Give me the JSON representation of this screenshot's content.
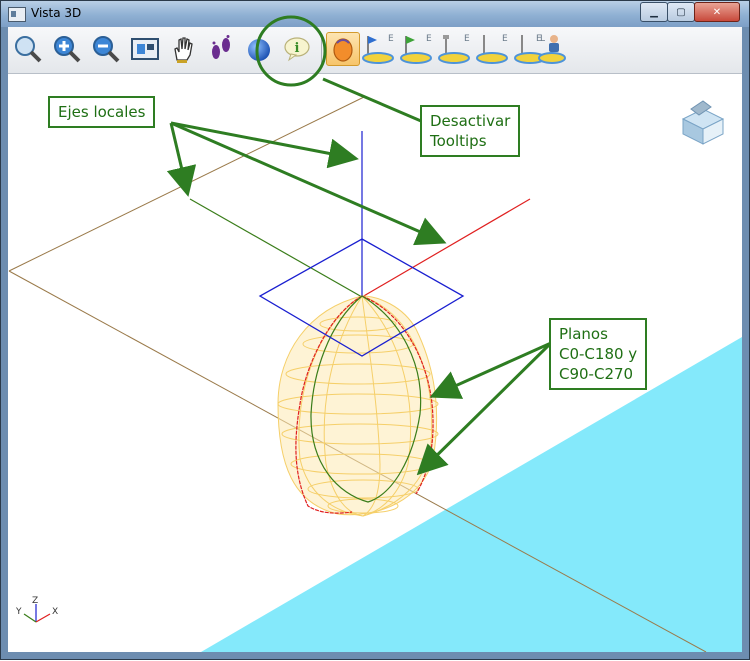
{
  "window": {
    "title": "Vista 3D",
    "controls": {
      "minimize": "▁",
      "maximize": "▢",
      "close": "✕"
    }
  },
  "toolbar": {
    "letters": [
      "E",
      "E",
      "E",
      "E",
      "L",
      "E"
    ]
  },
  "axes_indicator": {
    "x": "X",
    "y": "Y",
    "z": "Z"
  },
  "callouts": {
    "local_axes": "Ejes locales",
    "tooltips": "Desactivar\nTooltips",
    "planes": "Planos\nC0-C180 y\nC90-C270"
  },
  "colors": {
    "callout_green": "#2e7d22",
    "wireframe": "#f5cf69",
    "ground_plane": "#84e9fb",
    "axis_x": "#e02020",
    "axis_y": "#3a7d1a",
    "axis_z": "#1a1fd0",
    "floor_line": "#9a7a4a"
  }
}
